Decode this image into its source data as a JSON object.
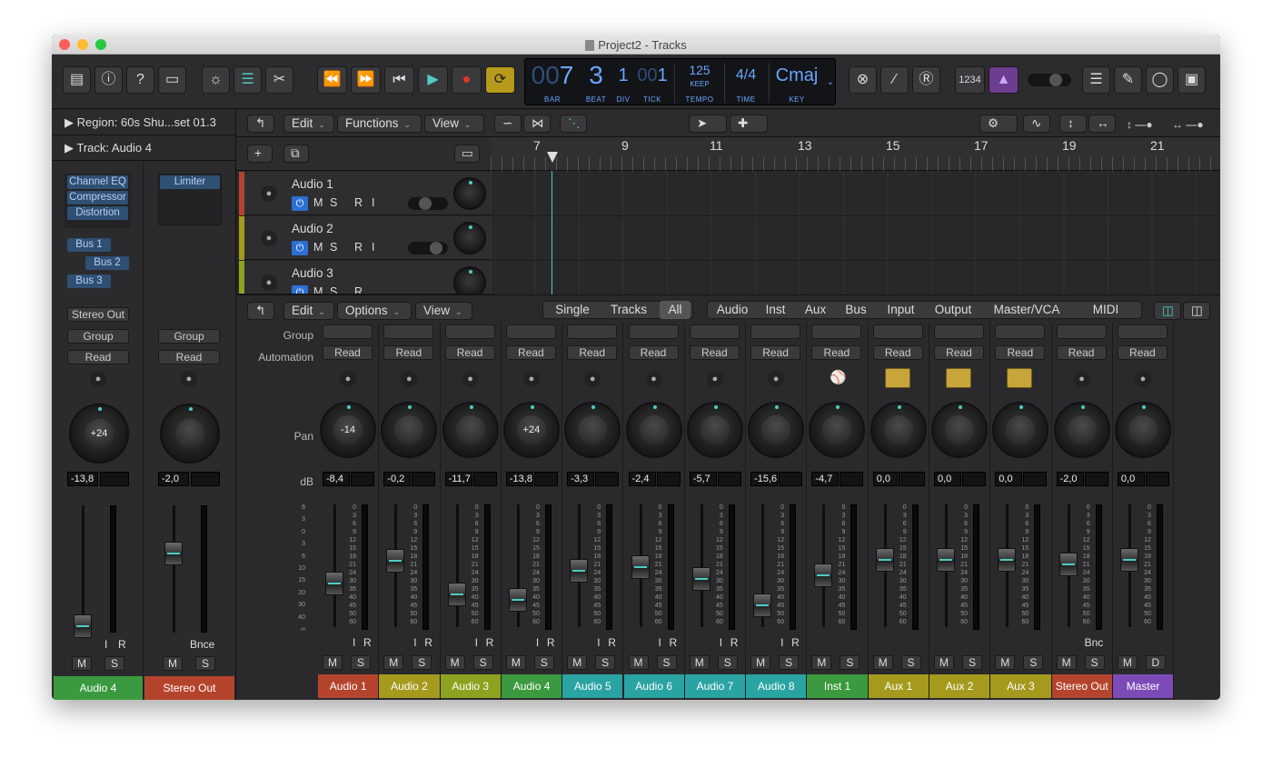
{
  "window": {
    "title": "Project2 - Tracks"
  },
  "lcd": {
    "bar": "7",
    "bar_dim": "00",
    "beat": "3",
    "div": "1",
    "tick": "1",
    "tick_dim": "00",
    "bar_label": "BAR",
    "beat_label": "BEAT",
    "div_label": "DIV",
    "tick_label": "TICK",
    "tempo": "125",
    "tempo_sub": "KEEP",
    "tempo_label": "TEMPO",
    "time_sig": "4/4",
    "time_label": "TIME",
    "key": "Cmaj",
    "key_label": "KEY"
  },
  "toolbar": {
    "count_in": "1234"
  },
  "inspector": {
    "region": "Region: 60s Shu...set 01.3",
    "track": "Track:  Audio 4",
    "left_plugins": [
      "Channel EQ",
      "Compressor",
      "Distortion"
    ],
    "right_plugins": [
      "Limiter"
    ],
    "sends": [
      "Bus 1",
      "Bus 2",
      "Bus 3"
    ],
    "output": "Stereo Out",
    "group": "Group",
    "automation": "Read",
    "left_pan": "+24",
    "left_db": "-13,8",
    "right_db": "-2,0",
    "bnce": "Bnce",
    "left_name": "Audio 4",
    "right_name": "Stereo Out",
    "i_lbl": "I",
    "r_lbl": "R",
    "m_lbl": "M",
    "s_lbl": "S"
  },
  "arrange": {
    "menus": [
      "Edit",
      "Functions",
      "View"
    ],
    "ruler": [
      "7",
      "9",
      "11",
      "13",
      "15",
      "17",
      "19",
      "21"
    ],
    "tracks": [
      {
        "name": "Audio 1",
        "color": "#b5442d"
      },
      {
        "name": "Audio 2",
        "color": "#a59a1e"
      },
      {
        "name": "Audio 3",
        "color": "#8da21e"
      }
    ],
    "m": "M",
    "s": "S",
    "r": "R",
    "i": "I"
  },
  "mixer": {
    "menus": [
      "Edit",
      "Options",
      "View"
    ],
    "scope": [
      "Single",
      "Tracks",
      "All"
    ],
    "filters": [
      "Audio",
      "Inst",
      "Aux",
      "Bus",
      "Input",
      "Output",
      "Master/VCA",
      "MIDI"
    ],
    "labels": {
      "group": "Group",
      "automation": "Automation",
      "pan": "Pan",
      "db": "dB"
    },
    "left_scale": [
      "6",
      "3",
      "0",
      "3",
      "6",
      "10",
      "15",
      "20",
      "30",
      "40",
      "∞"
    ],
    "meter_scale": [
      "0",
      "3",
      "6",
      "9",
      "12",
      "15",
      "18",
      "21",
      "24",
      "30",
      "35",
      "40",
      "45",
      "50",
      "60"
    ],
    "strips": [
      {
        "name": "Audio 1",
        "color": "#b5442d",
        "automation": "Read",
        "pan": "-14",
        "db": "-8,4",
        "fader": 0.56,
        "icon": "mic",
        "ir": true,
        "b2": "S"
      },
      {
        "name": "Audio 2",
        "color": "#a59a1e",
        "automation": "Read",
        "pan": "",
        "db": "-0,2",
        "fader": 0.35,
        "icon": "mic",
        "ir": true,
        "b2": "S"
      },
      {
        "name": "Audio 3",
        "color": "#8da21e",
        "automation": "Read",
        "pan": "",
        "db": "-11,7",
        "fader": 0.66,
        "icon": "mic",
        "ir": true,
        "b2": "S"
      },
      {
        "name": "Audio 4",
        "color": "#3b9a3f",
        "automation": "Read",
        "pan": "+24",
        "db": "-13,8",
        "fader": 0.71,
        "icon": "mic",
        "ir": true,
        "b2": "S"
      },
      {
        "name": "Audio 5",
        "color": "#2aa3a3",
        "automation": "Read",
        "pan": "",
        "db": "-3,3",
        "fader": 0.44,
        "icon": "mic",
        "ir": true,
        "b2": "S"
      },
      {
        "name": "Audio 6",
        "color": "#2aa3a3",
        "automation": "Read",
        "pan": "",
        "db": "-2,4",
        "fader": 0.41,
        "icon": "mic",
        "ir": true,
        "b2": "S"
      },
      {
        "name": "Audio 7",
        "color": "#2aa3a3",
        "automation": "Read",
        "pan": "",
        "db": "-5,7",
        "fader": 0.52,
        "icon": "mic",
        "ir": true,
        "b2": "S"
      },
      {
        "name": "Audio 8",
        "color": "#2aa3a3",
        "automation": "Read",
        "pan": "",
        "db": "-15,6",
        "fader": 0.76,
        "icon": "mic",
        "ir": true,
        "b2": "S"
      },
      {
        "name": "Inst 1",
        "color": "#3b9a3f",
        "automation": "Read",
        "pan": "",
        "db": "-4,7",
        "fader": 0.48,
        "icon": "keyboard",
        "ir": false,
        "b2": "S"
      },
      {
        "name": "Aux 1",
        "color": "#a59a1e",
        "automation": "Read",
        "pan": "",
        "db": "0,0",
        "fader": 0.34,
        "icon": "aux",
        "ir": false,
        "b2": "S"
      },
      {
        "name": "Aux 2",
        "color": "#a59a1e",
        "automation": "Read",
        "pan": "",
        "db": "0,0",
        "fader": 0.34,
        "icon": "aux",
        "ir": false,
        "b2": "S"
      },
      {
        "name": "Aux 3",
        "color": "#a59a1e",
        "automation": "Read",
        "pan": "",
        "db": "0,0",
        "fader": 0.34,
        "icon": "aux",
        "ir": false,
        "b2": "S"
      },
      {
        "name": "Stereo Out",
        "color": "#b5442d",
        "automation": "Read",
        "pan": "",
        "db": "-2,0",
        "fader": 0.38,
        "icon": "mic",
        "ir": false,
        "b2": "S",
        "bnc": "Bnc"
      },
      {
        "name": "Master",
        "color": "#7d4bb8",
        "automation": "Read",
        "pan": "",
        "db": "0,0",
        "fader": 0.34,
        "icon": "mic",
        "ir": false,
        "b2": "D",
        "master": true
      }
    ]
  }
}
